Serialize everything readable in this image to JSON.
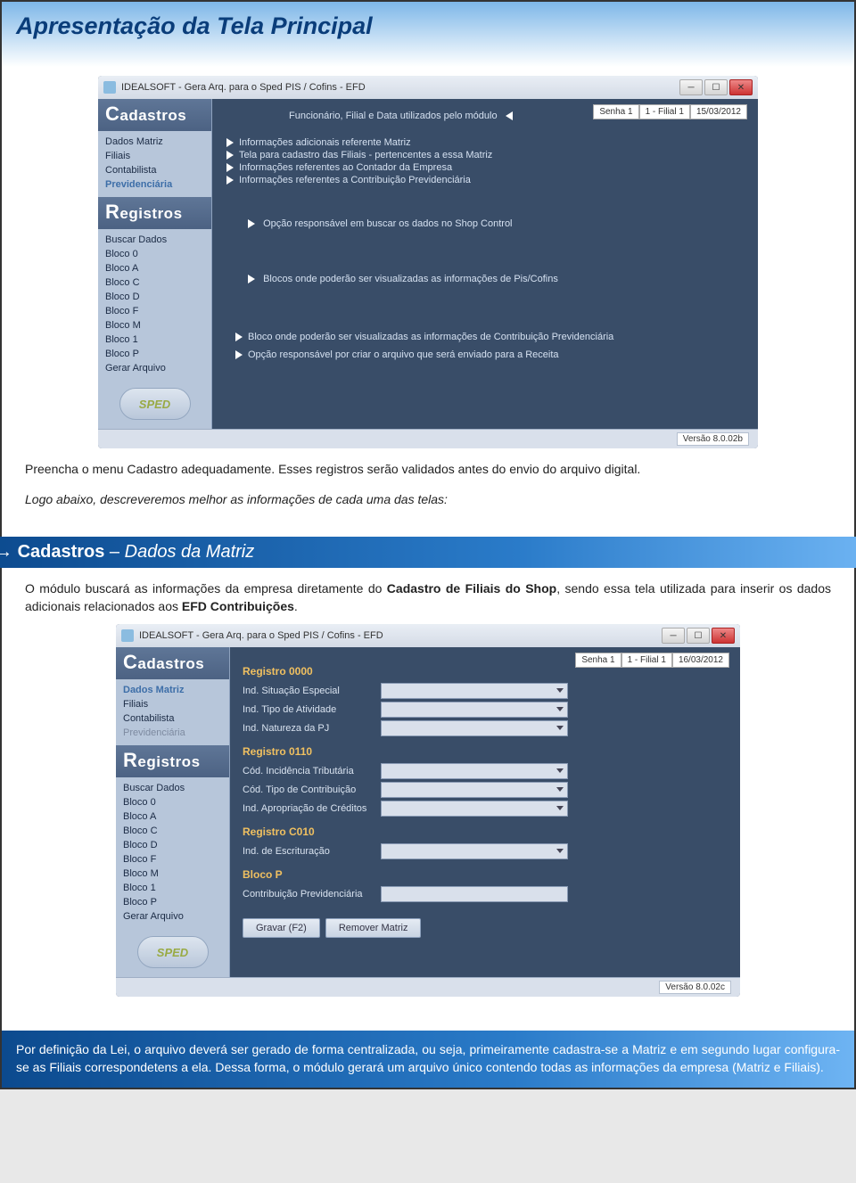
{
  "banner_title": "Apresentação da Tela Principal",
  "win1": {
    "title": "IDEALSOFT - Gera Arq. para o Sped PIS / Cofins - EFD",
    "top_fields": [
      "Senha 1",
      "1 - Filial 1",
      "15/03/2012"
    ],
    "status": "Versão 8.0.02b",
    "sidebar": {
      "sect1_title": "Cadastros",
      "sect1_items": [
        "Dados Matriz",
        "Filiais",
        "Contabilista",
        "Previdenciária"
      ],
      "sect1_hl_index": 3,
      "sect2_title": "Registros",
      "sect2_items": [
        "Buscar Dados",
        "Bloco 0",
        "Bloco A",
        "Bloco C",
        "Bloco D",
        "Bloco F",
        "Bloco M",
        "Bloco 1",
        "Bloco P",
        "Gerar Arquivo"
      ]
    },
    "annot": {
      "top_text": "Funcionário, Filial e Data utilizados pelo módulo",
      "cad": [
        "Informações adicionais referente Matriz",
        "Tela para cadastro das Filiais - pertencentes a essa Matriz",
        "Informações referentes ao Contador da Empresa",
        "Informações referentes a Contribuição Previdenciária"
      ],
      "a1": "Opção responsável em buscar os dados no Shop Control",
      "a2": "Blocos onde poderão ser visualizadas as informações de Pis/Cofins",
      "a3": "Bloco onde poderão ser visualizadas as informações de Contribuição Previdenciária",
      "a4": "Opção responsável por criar o arquivo que será enviado para a Receita"
    }
  },
  "para1": "Preencha o menu Cadastro adequadamente. Esses registros serão validados antes do envio do arquivo digital.",
  "para2": "Logo abaixo, descreveremos melhor as informações de cada uma das telas:",
  "section": {
    "arrow": "→",
    "main": "Cadastros",
    "sub": "Dados da Matriz"
  },
  "para3a": "O módulo buscará as informações da empresa diretamente do ",
  "para3b": "Cadastro de Filiais do Shop",
  "para3c": ", sendo essa tela utilizada para inserir os dados adicionais relacionados aos ",
  "para3d": "EFD Contribuições",
  "para3e": ".",
  "win2": {
    "title": "IDEALSOFT - Gera Arq. para o Sped PIS / Cofins - EFD",
    "top_fields": [
      "Senha 1",
      "1 - Filial   1",
      "16/03/2012"
    ],
    "status": "Versão 8.0.02c",
    "sidebar": {
      "sect1_title": "Cadastros",
      "sect1_items": [
        "Dados Matriz",
        "Filiais",
        "Contabilista",
        "Previdenciária"
      ],
      "sect1_hl_index": 0,
      "sect1_dim_index": 3,
      "sect2_title": "Registros",
      "sect2_items": [
        "Buscar Dados",
        "Bloco 0",
        "Bloco A",
        "Bloco C",
        "Bloco D",
        "Bloco F",
        "Bloco M",
        "Bloco 1",
        "Bloco P",
        "Gerar Arquivo"
      ]
    },
    "form": {
      "g1_title": "Registro 0000",
      "g1": [
        {
          "label": "Ind. Situação Especial",
          "type": "dd"
        },
        {
          "label": "Ind. Tipo de Atividade",
          "type": "dd"
        },
        {
          "label": "Ind. Natureza da PJ",
          "type": "dd"
        }
      ],
      "g2_title": "Registro 0110",
      "g2": [
        {
          "label": "Cód. Incidência Tributária",
          "type": "dd"
        },
        {
          "label": "Cód. Tipo de Contribuição",
          "type": "dd"
        },
        {
          "label": "Ind. Apropriação de Créditos",
          "type": "dd"
        }
      ],
      "g3_title": "Registro C010",
      "g3": [
        {
          "label": "Ind. de Escrituração",
          "type": "dd"
        }
      ],
      "g4_title": "Bloco P",
      "g4": [
        {
          "label": "Contribuição Previdenciária",
          "type": "tb"
        }
      ],
      "buttons": [
        "Gravar (F2)",
        "Remover Matriz"
      ]
    }
  },
  "infobox": "Por definição da Lei, o arquivo deverá ser gerado de forma centralizada, ou seja, primeiramente cadastra-se a Matriz e em segundo lugar configura-se as Filiais correspondetens a ela. Dessa forma, o módulo gerará um arquivo único contendo todas as informações da empresa (Matriz e Filiais)."
}
